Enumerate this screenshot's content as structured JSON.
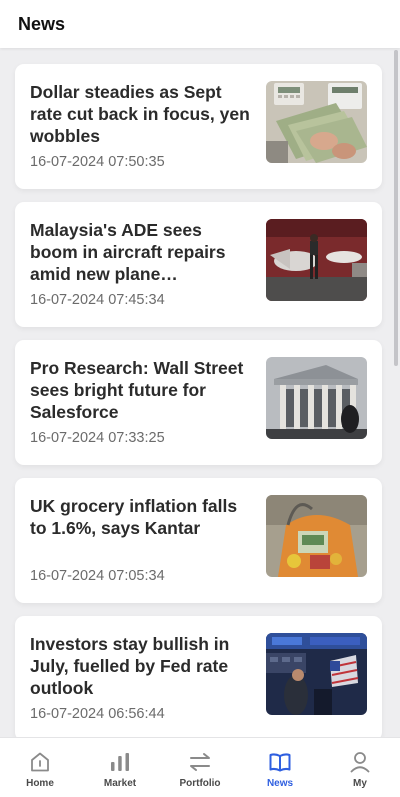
{
  "header": {
    "title": "News"
  },
  "articles": [
    {
      "title": "Dollar steadies as Sept rate cut back in focus, yen wobbles",
      "time": "16-07-2024 07:50:35",
      "image": "currency-banknotes-image"
    },
    {
      "title": "Malaysia's ADE sees boom in aircraft repairs amid new plane…",
      "time": "16-07-2024 07:45:34",
      "image": "aircraft-hangar-image"
    },
    {
      "title": "Pro Research: Wall Street sees bright future for Salesforce",
      "time": "16-07-2024 07:33:25",
      "image": "stock-exchange-building-image"
    },
    {
      "title": "UK grocery inflation falls to 1.6%, says Kantar",
      "time": "16-07-2024 07:05:34",
      "image": "grocery-bag-image"
    },
    {
      "title": "Investors stay bullish in July, fuelled by Fed rate outlook",
      "time": "16-07-2024 06:56:44",
      "image": "trading-floor-image"
    }
  ],
  "tabs": [
    {
      "label": "Home",
      "icon": "home-icon",
      "active": false
    },
    {
      "label": "Market",
      "icon": "bar-chart-icon",
      "active": false
    },
    {
      "label": "Portfolio",
      "icon": "transfer-arrows-icon",
      "active": false
    },
    {
      "label": "News",
      "icon": "open-book-icon",
      "active": true
    },
    {
      "label": "My",
      "icon": "user-icon",
      "active": false
    }
  ],
  "colors": {
    "accent": "#2f5fe0",
    "background": "#eeeef0",
    "card": "#ffffff",
    "tab_inactive": "#8a8a8a"
  }
}
